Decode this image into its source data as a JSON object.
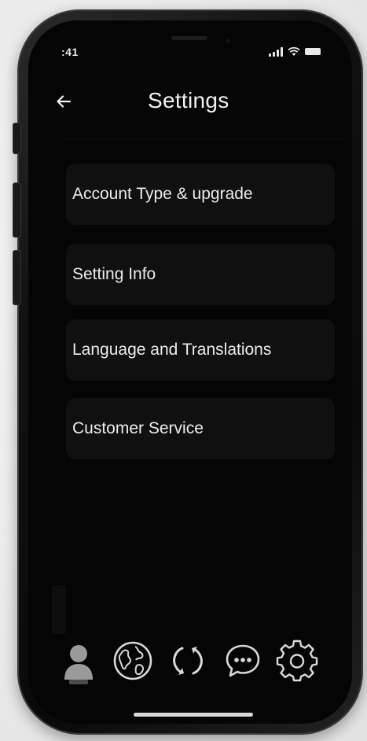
{
  "status_bar": {
    "time": ":41",
    "icons": [
      "cellular-signal-icon",
      "wifi-icon",
      "battery-icon"
    ]
  },
  "header": {
    "title": "Settings",
    "back_icon": "back-arrow-icon"
  },
  "menu": {
    "items": [
      {
        "label": "Account Type & upgrade"
      },
      {
        "label": "Setting Info"
      },
      {
        "label": "Language and Translations"
      },
      {
        "label": "Customer Service"
      }
    ]
  },
  "tab_bar": {
    "tabs": [
      {
        "icon": "person-icon",
        "active": true
      },
      {
        "icon": "globe-icon",
        "active": false
      },
      {
        "icon": "sync-icon",
        "active": false
      },
      {
        "icon": "chat-bubble-icon",
        "active": false
      },
      {
        "icon": "gear-icon",
        "active": false
      }
    ]
  },
  "colors": {
    "screen_background": "#050505",
    "card_background": "#101010",
    "text_primary": "#f2f2f2",
    "icon_active": "#9a9a9a",
    "icon_inactive": "#d8d8d8"
  }
}
